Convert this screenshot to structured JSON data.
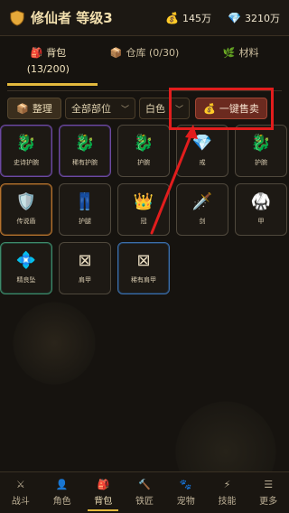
{
  "header": {
    "title": "修仙者 等级3",
    "title_icon": "shield-icon",
    "coins_icon": "money-bag-icon",
    "coins": "145万",
    "gems_icon": "diamond-icon",
    "gems": "3210万"
  },
  "tabs": [
    {
      "icon": "backpack-icon",
      "label": "背包",
      "sub": "(13/200)",
      "active": true
    },
    {
      "icon": "box-icon",
      "label": "仓库 (0/30)",
      "active": false
    },
    {
      "icon": "herb-icon",
      "label": "材料",
      "active": false
    }
  ],
  "toolbar": {
    "sort_label": "整理",
    "slot_filter": "全部部位",
    "quality_filter": "白色",
    "sell_label": "一键售卖"
  },
  "items": [
    {
      "icon": "🐉",
      "name": "史诗护腕",
      "quality": "purple"
    },
    {
      "icon": "🐉",
      "name": "稀有护腕",
      "quality": "purple"
    },
    {
      "icon": "🐉",
      "name": "护腕",
      "quality": "gray"
    },
    {
      "icon": "💎",
      "name": "戒",
      "quality": "gray"
    },
    {
      "icon": "🐉",
      "name": "护腕",
      "quality": "gray"
    },
    {
      "icon": "🛡️",
      "name": "传说盾",
      "quality": "orange"
    },
    {
      "icon": "👖",
      "name": "护腿",
      "quality": "gray"
    },
    {
      "icon": "👑",
      "name": "冠",
      "quality": "gray"
    },
    {
      "icon": "🗡️",
      "name": "剑",
      "quality": "gray"
    },
    {
      "icon": "🥋",
      "name": "甲",
      "quality": "gray"
    },
    {
      "icon": "💠",
      "name": "精良坠",
      "quality": "green"
    },
    {
      "icon": "⊠",
      "name": "肩甲",
      "quality": "gray"
    },
    {
      "icon": "⊠",
      "name": "稀有肩甲",
      "quality": "blue"
    }
  ],
  "bottom_nav": [
    {
      "icon": "⚔",
      "label": "战斗"
    },
    {
      "icon": "👤",
      "label": "角色"
    },
    {
      "icon": "🎒",
      "label": "背包",
      "active": true
    },
    {
      "icon": "🔨",
      "label": "铁匠"
    },
    {
      "icon": "🐾",
      "label": "宠物"
    },
    {
      "icon": "⚡",
      "label": "技能"
    },
    {
      "icon": "☰",
      "label": "更多"
    }
  ]
}
